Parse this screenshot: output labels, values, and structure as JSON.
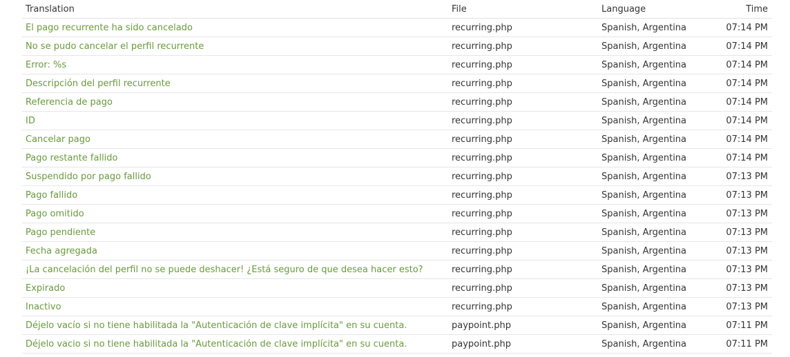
{
  "table": {
    "headers": {
      "translation": "Translation",
      "file": "File",
      "language": "Language",
      "time": "Time"
    },
    "rows": [
      {
        "translation": "El pago recurrente ha sido cancelado",
        "file": "recurring.php",
        "language": "Spanish, Argentina",
        "time": "07:14 PM"
      },
      {
        "translation": "No se pudo cancelar el perfil recurrente",
        "file": "recurring.php",
        "language": "Spanish, Argentina",
        "time": "07:14 PM"
      },
      {
        "translation": "Error: %s",
        "file": "recurring.php",
        "language": "Spanish, Argentina",
        "time": "07:14 PM"
      },
      {
        "translation": "Descripción del perfil recurrente",
        "file": "recurring.php",
        "language": "Spanish, Argentina",
        "time": "07:14 PM"
      },
      {
        "translation": "Referencia de pago",
        "file": "recurring.php",
        "language": "Spanish, Argentina",
        "time": "07:14 PM"
      },
      {
        "translation": "ID",
        "file": "recurring.php",
        "language": "Spanish, Argentina",
        "time": "07:14 PM"
      },
      {
        "translation": "Cancelar pago",
        "file": "recurring.php",
        "language": "Spanish, Argentina",
        "time": "07:14 PM"
      },
      {
        "translation": "Pago restante fallido",
        "file": "recurring.php",
        "language": "Spanish, Argentina",
        "time": "07:14 PM"
      },
      {
        "translation": "Suspendido por pago fallido",
        "file": "recurring.php",
        "language": "Spanish, Argentina",
        "time": "07:13 PM"
      },
      {
        "translation": "Pago fallido",
        "file": "recurring.php",
        "language": "Spanish, Argentina",
        "time": "07:13 PM"
      },
      {
        "translation": "Pago omitido",
        "file": "recurring.php",
        "language": "Spanish, Argentina",
        "time": "07:13 PM"
      },
      {
        "translation": "Pago pendiente",
        "file": "recurring.php",
        "language": "Spanish, Argentina",
        "time": "07:13 PM"
      },
      {
        "translation": "Fecha agregada",
        "file": "recurring.php",
        "language": "Spanish, Argentina",
        "time": "07:13 PM"
      },
      {
        "translation": "¡La cancelación del perfil no se puede deshacer! ¿Está seguro de que desea hacer esto?",
        "file": "recurring.php",
        "language": "Spanish, Argentina",
        "time": "07:13 PM"
      },
      {
        "translation": "Expirado",
        "file": "recurring.php",
        "language": "Spanish, Argentina",
        "time": "07:13 PM"
      },
      {
        "translation": "Inactivo",
        "file": "recurring.php",
        "language": "Spanish, Argentina",
        "time": "07:13 PM"
      },
      {
        "translation": "Déjelo vacío si no tiene habilitada la \"Autenticación de clave implícita\" en su cuenta.",
        "file": "paypoint.php",
        "language": "Spanish, Argentina",
        "time": "07:11 PM"
      },
      {
        "translation": "Déjelo vacio si no tiene habilitada la \"Autenticación de clave implícita\" en su cuenta.",
        "file": "paypoint.php",
        "language": "Spanish, Argentina",
        "time": "07:11 PM"
      }
    ]
  },
  "colors": {
    "link": "#6a9a3c",
    "text": "#333333",
    "row_border": "#e6e6e6"
  }
}
